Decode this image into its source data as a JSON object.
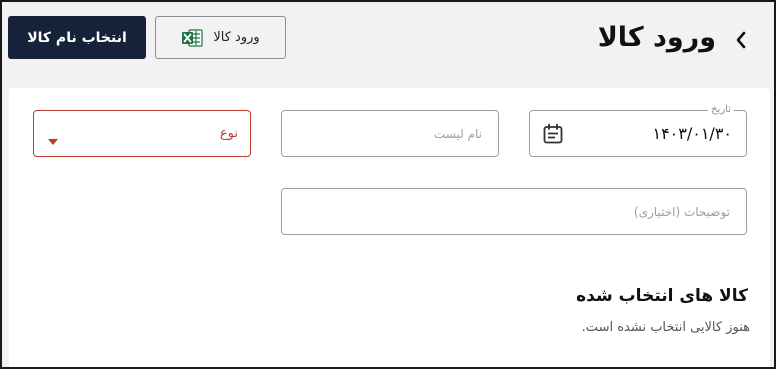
{
  "header": {
    "title": "ورود کالا",
    "select_button_label": "انتخاب نام کالا",
    "import_button_label": "ورود کالا"
  },
  "form": {
    "date": {
      "label": "تاریخ",
      "value": "۱۴۰۳/۰۱/۳۰"
    },
    "list_name": {
      "placeholder": "نام لیست"
    },
    "type": {
      "placeholder": "نوع"
    },
    "description": {
      "placeholder": "توضیحات (اختیاری)"
    }
  },
  "selected_items": {
    "title": "کالا های انتخاب شده",
    "empty_message": "هنوز کالایی انتخاب نشده است."
  },
  "colors": {
    "primary": "#16213a",
    "error": "#c0392b",
    "excel": "#1e7145"
  },
  "icons": [
    "chevron-left-icon",
    "excel-icon",
    "calendar-icon",
    "caret-down-icon"
  ]
}
